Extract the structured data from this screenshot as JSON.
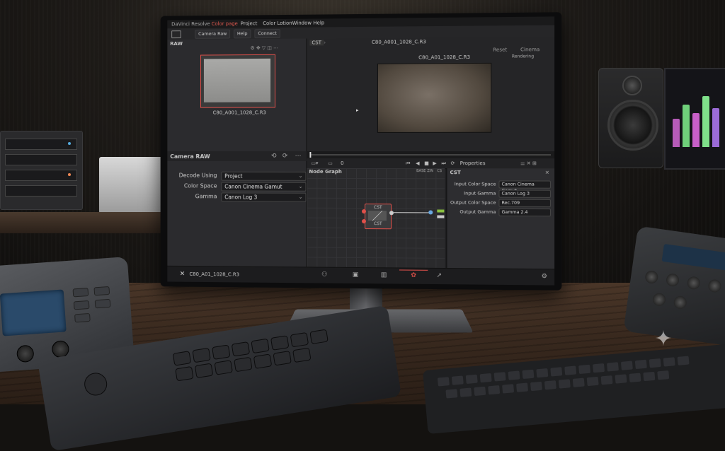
{
  "menu": {
    "app": "DaVinci Resolve",
    "page": "Color page",
    "items": [
      "Project",
      "Color Lotion",
      "Window",
      "Help"
    ]
  },
  "toolbar": {
    "camera_raw": "Camera Raw",
    "help": "Help",
    "connect": "Connect"
  },
  "raw_panel": {
    "title": "RAW",
    "clip_name": "C80_A001_1028_C.R3"
  },
  "viewer": {
    "tab": "CST",
    "clip_title": "C80_A001_1028_C.R3",
    "overlay_title": "C80_A01_1028_C.R3",
    "status": "Rendering",
    "button_a": "Reset",
    "button_b": "Cinema"
  },
  "transport": {
    "frame": "0",
    "properties": "Properties"
  },
  "camera_raw": {
    "title": "Camera RAW",
    "rows": [
      {
        "label": "Decode Using",
        "value": "Project"
      },
      {
        "label": "Color Space",
        "value": "Canon Cinema Gamut"
      },
      {
        "label": "Gamma",
        "value": "Canon Log 3"
      }
    ]
  },
  "node_graph": {
    "title": "Node Graph",
    "node_top": "CST",
    "node_bottom": "CST",
    "header_right": [
      "BASE",
      "ZIN",
      "CS"
    ]
  },
  "cst": {
    "title": "CST",
    "rows": [
      {
        "label": "Input Color Space",
        "value": "Canon Cinema Gamut"
      },
      {
        "label": "Input Gamma",
        "value": "Canon Log 3"
      },
      {
        "label": "Output Color Space",
        "value": "Rec.709"
      },
      {
        "label": "Output Gamma",
        "value": "Gamma 2.4"
      }
    ]
  },
  "footer": {
    "clip_name": "C80_A01_1028_C.R3"
  },
  "colors": {
    "accent_red": "#e0504a",
    "panel_bg": "#2b2b2e"
  },
  "icons": [
    "monitor-icon",
    "gear-icon",
    "play-icon",
    "stop-icon",
    "rewind-icon",
    "forward-icon",
    "loop-icon",
    "resolve-logo-icon",
    "sparkle-icon"
  ]
}
